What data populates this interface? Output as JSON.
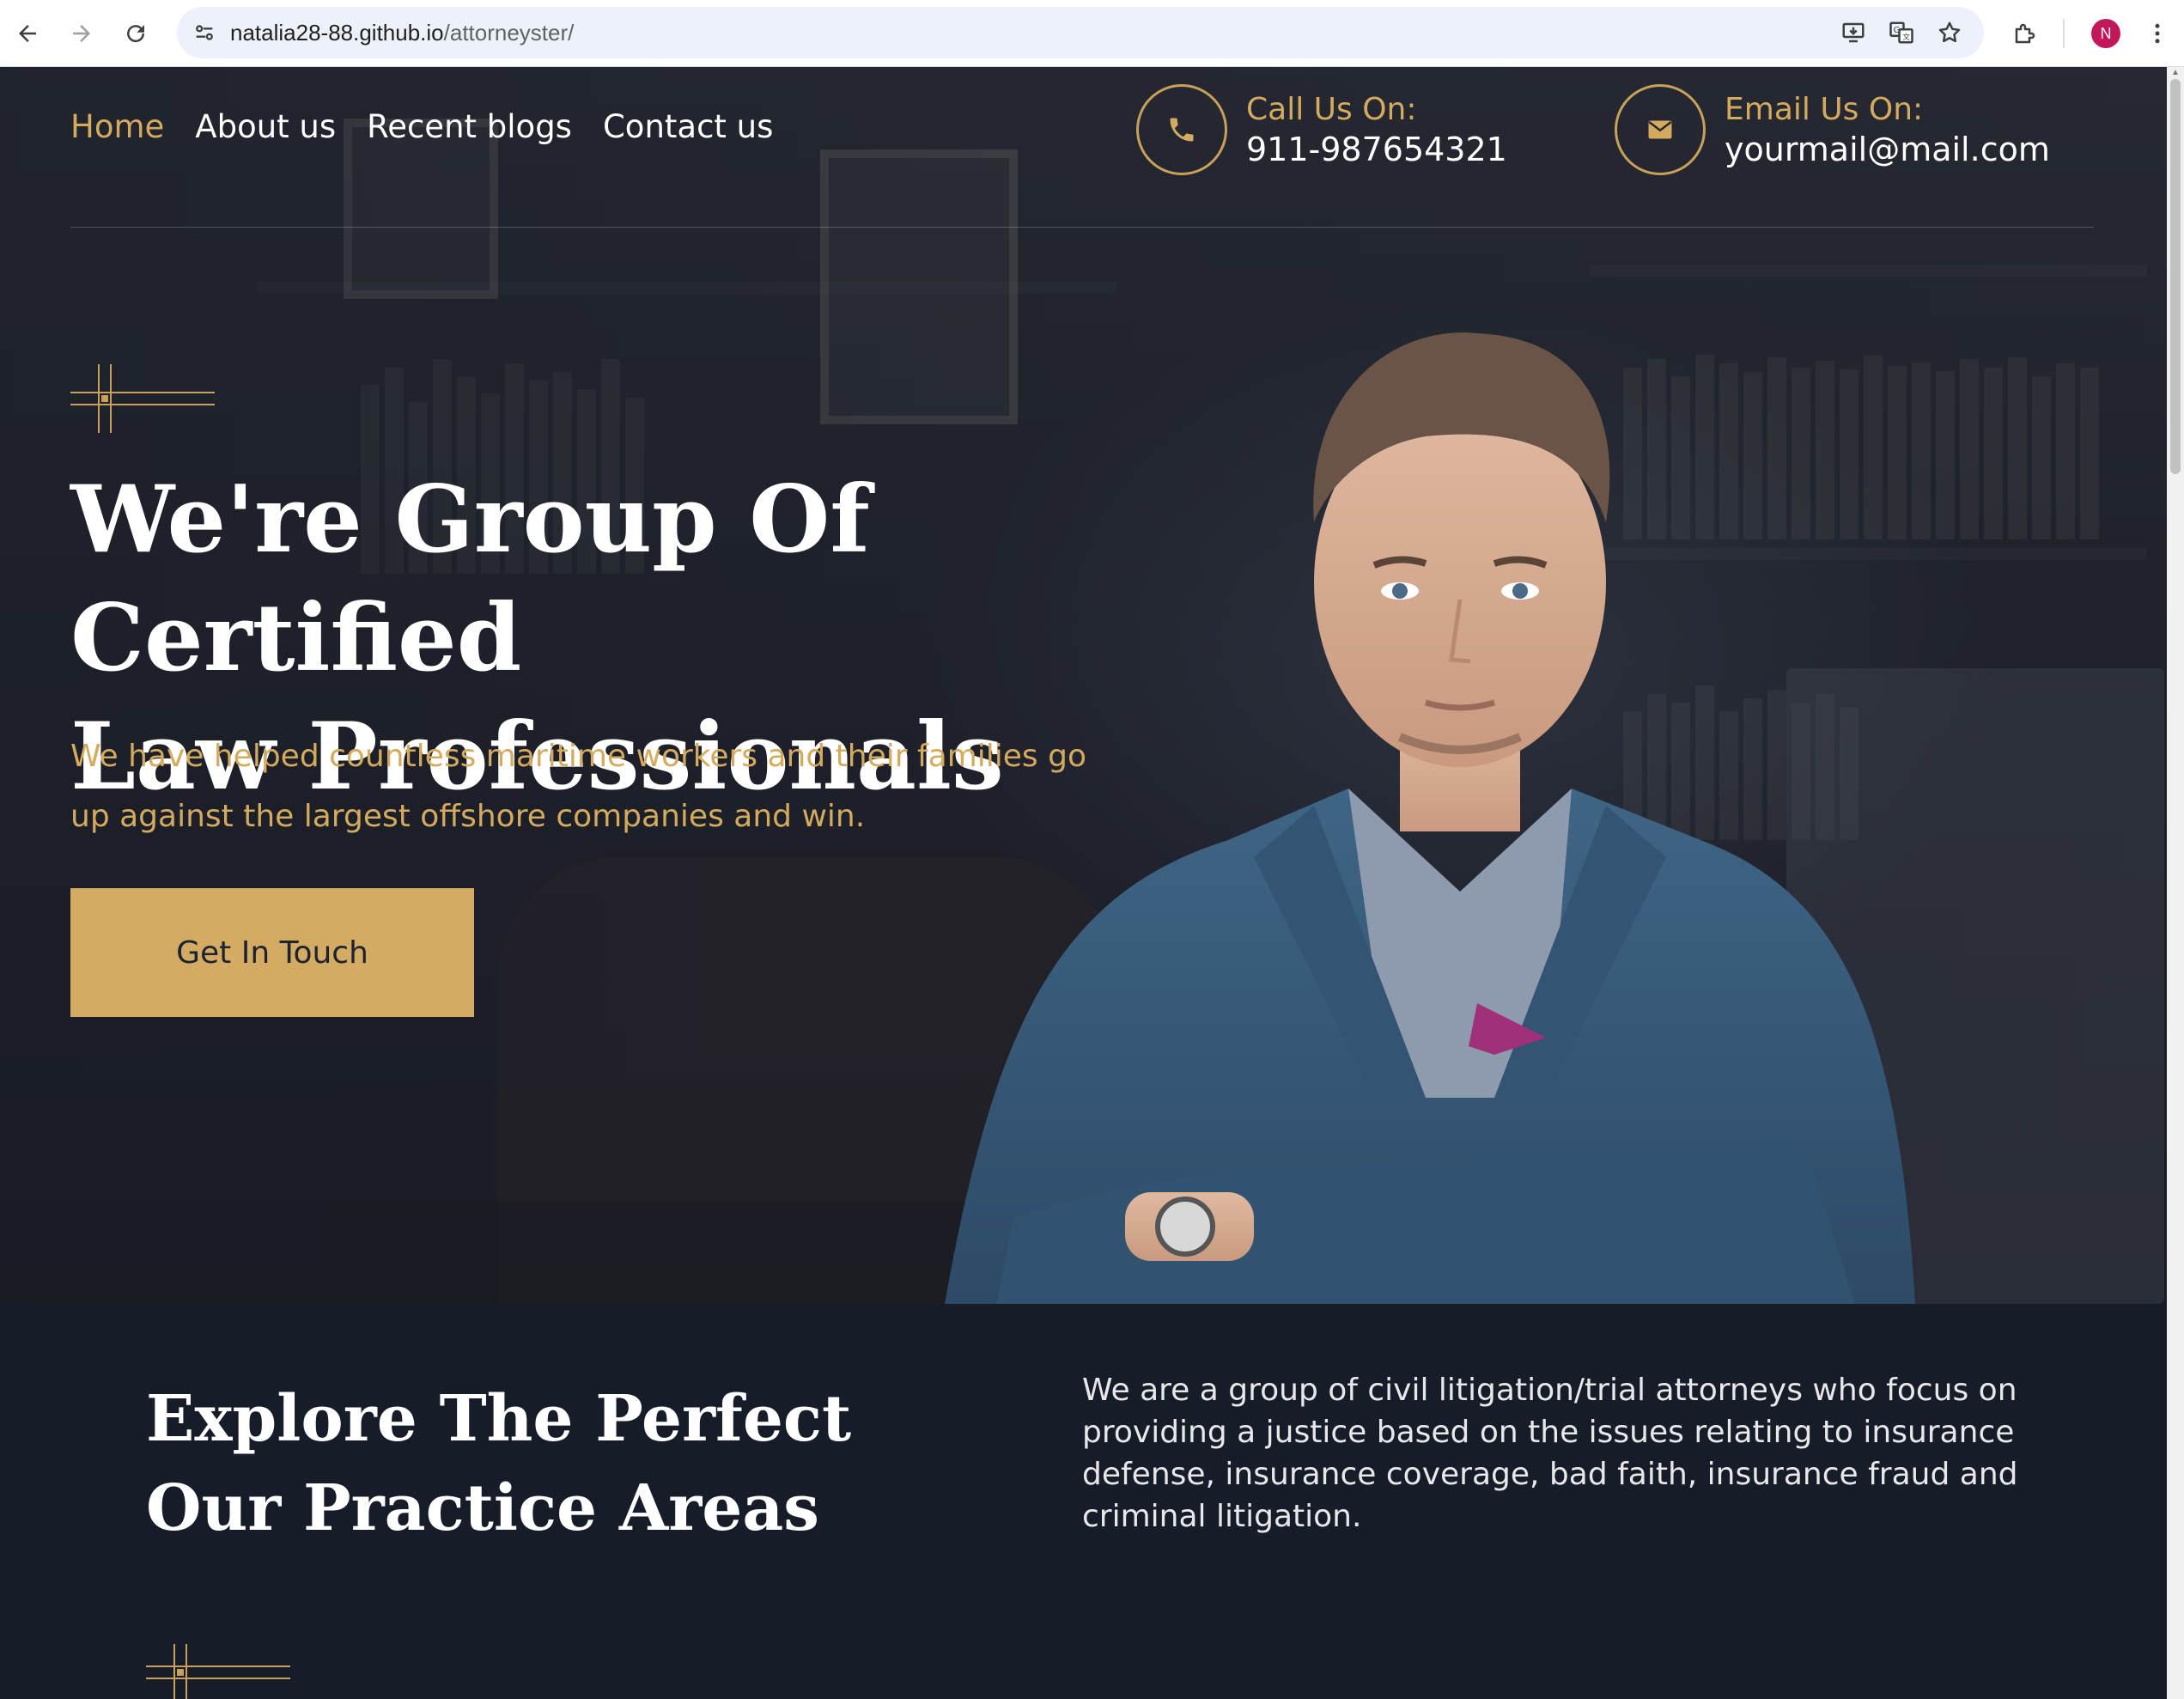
{
  "browser": {
    "url_host": "natalia28-88.github.io",
    "url_path": "/attorneyster/",
    "avatar_letter": "N",
    "icons": {
      "back": "arrow-left-icon",
      "forward": "arrow-right-icon",
      "reload": "reload-icon",
      "site_info": "tune-icon",
      "install": "install-app-icon",
      "translate": "translate-icon",
      "bookmark": "star-icon",
      "extensions": "puzzle-icon",
      "menu": "kebab-menu-icon"
    }
  },
  "nav": {
    "items": [
      {
        "label": "Home",
        "active": true
      },
      {
        "label": "About us",
        "active": false
      },
      {
        "label": "Recent blogs",
        "active": false
      },
      {
        "label": "Contact us",
        "active": false
      }
    ]
  },
  "contact": {
    "call_label": "Call Us On:",
    "call_value": "911-987654321",
    "email_label": "Email Us On:",
    "email_value": "yourmail@mail.com"
  },
  "hero": {
    "title_line1": "We're Group Of Certified",
    "title_line2": "Law Professionals",
    "subtitle": "We have helped countless maritime workers and their families go up against the largest offshore companies and win.",
    "cta_label": "Get In Touch"
  },
  "practice": {
    "title_line1": "Explore The Perfect",
    "title_line2": "Our Practice Areas",
    "description": "We are a group of civil litigation/trial attorneys who focus on providing a justice based on the issues relating to insurance defense, insurance coverage, bad faith, insurance fraud and criminal litigation."
  },
  "colors": {
    "accent_gold": "#d4aa5f",
    "hero_bg": "#23262f",
    "section_bg": "#161c28",
    "text_white": "#ffffff"
  }
}
